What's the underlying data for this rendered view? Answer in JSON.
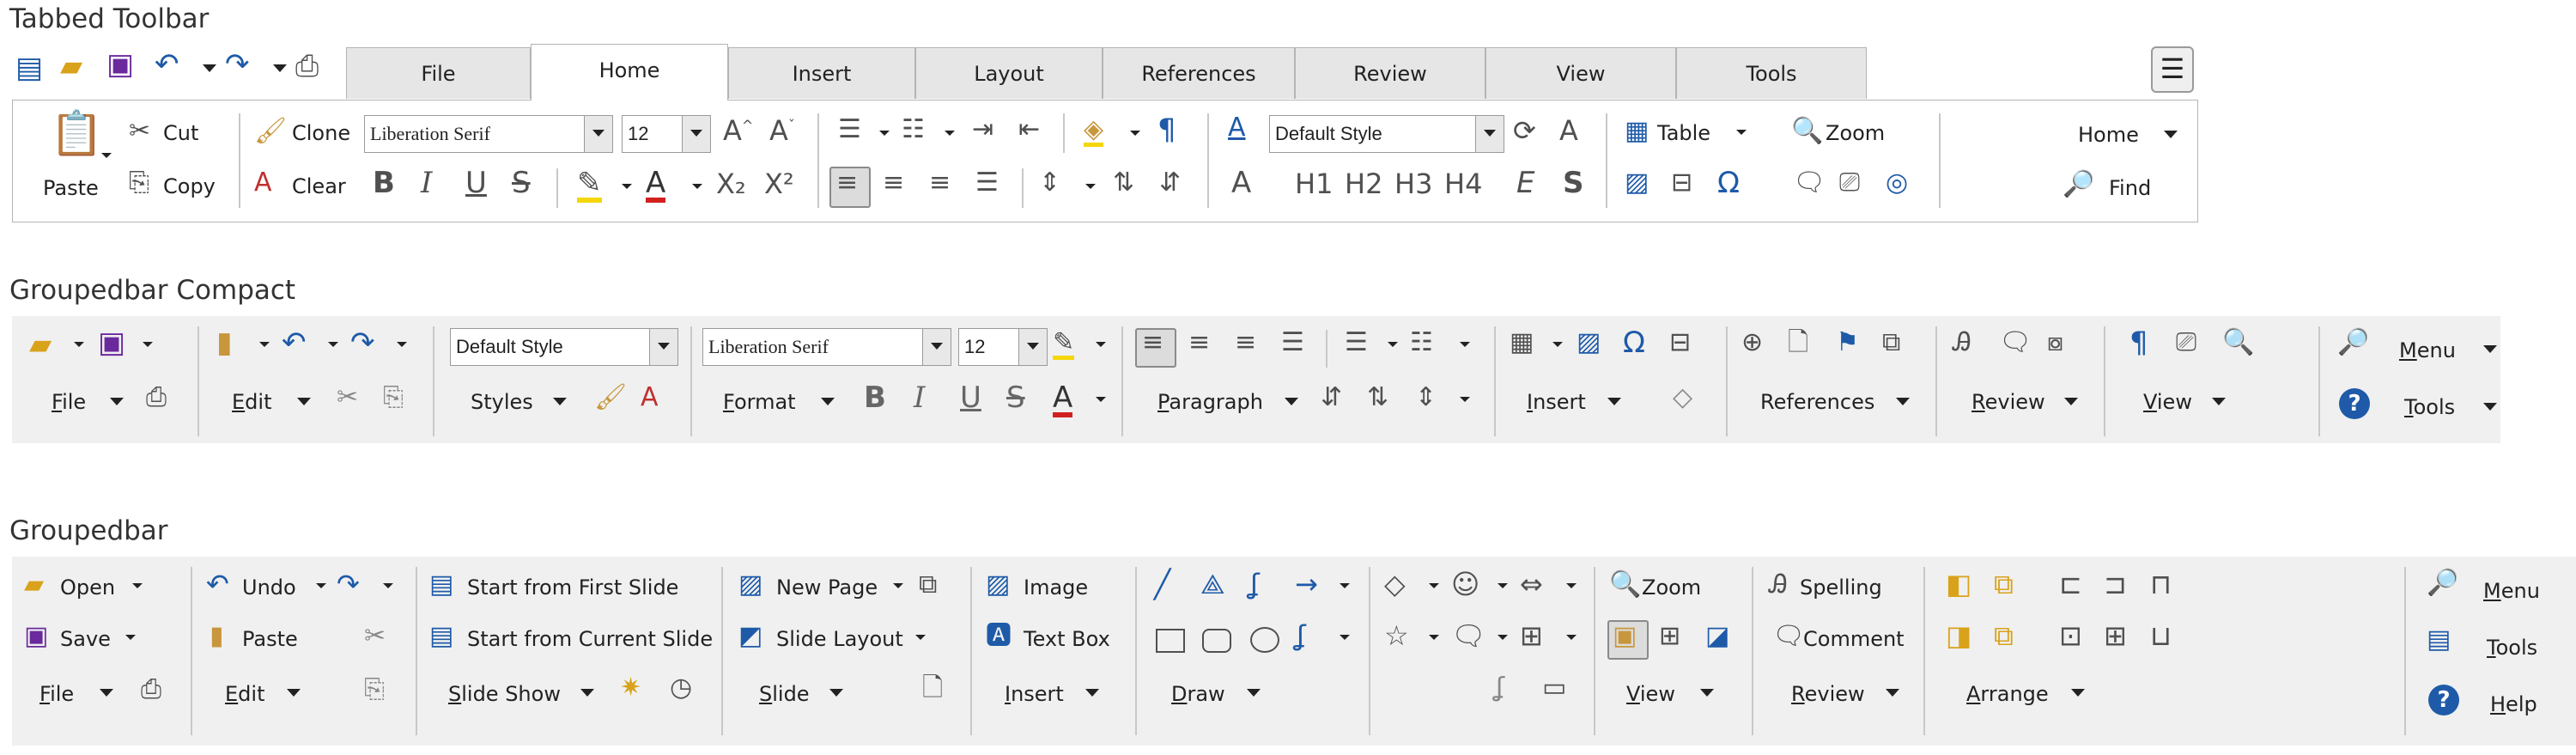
{
  "headings": {
    "tabbed": "Tabbed Toolbar",
    "compact": "Groupedbar Compact",
    "grouped": "Groupedbar"
  },
  "tabbed": {
    "tabs": [
      "File",
      "Home",
      "Insert",
      "Layout",
      "References",
      "Review",
      "View",
      "Tools"
    ],
    "active_tab": "Home",
    "paste": "Paste",
    "cut": "Cut",
    "copy": "Copy",
    "clone": "Clone",
    "clear": "Clear",
    "font_name": "Liberation Serif",
    "font_size": "12",
    "para_style": "Default Style",
    "table": "Table",
    "zoom": "Zoom",
    "home": "Home",
    "find": "Find",
    "heading_glyphs": [
      "H1",
      "H2",
      "H3",
      "H4"
    ],
    "letters": {
      "bold": "B",
      "italic": "I",
      "underline": "U",
      "strike": "S",
      "sub": "X₂",
      "sup": "X²",
      "big_a": "A",
      "emph": "E",
      "strong": "S",
      "omega": "Ω",
      "pilcrow": "¶"
    }
  },
  "compact": {
    "file": "File",
    "edit": "Edit",
    "styles": "Styles",
    "style_value": "Default Style",
    "font_name": "Liberation Serif",
    "font_size": "12",
    "format": "Format",
    "paragraph": "Paragraph",
    "insert": "Insert",
    "references": "References",
    "review": "Review",
    "view": "View",
    "menu": "Menu",
    "tools": "Tools"
  },
  "grouped": {
    "open": "Open",
    "save": "Save",
    "file": "File",
    "undo": "Undo",
    "paste": "Paste",
    "edit": "Edit",
    "start_first": "Start from First Slide",
    "start_current": "Start from Current Slide",
    "slide_show": "Slide Show",
    "new_page": "New Page",
    "slide_layout": "Slide Layout",
    "slide": "Slide",
    "image": "Image",
    "text_box": "Text Box",
    "insert": "Insert",
    "draw": "Draw",
    "zoom": "Zoom",
    "view": "View",
    "spelling": "Spelling",
    "comment": "Comment",
    "review": "Review",
    "arrange": "Arrange",
    "menu": "Menu",
    "tools": "Tools",
    "help": "Help"
  },
  "colors": {
    "accent_blue": "#1e5aa8",
    "font_red": "#d22020",
    "highlight_yellow": "#f5d60a",
    "save_purple": "#6a2a9e"
  }
}
